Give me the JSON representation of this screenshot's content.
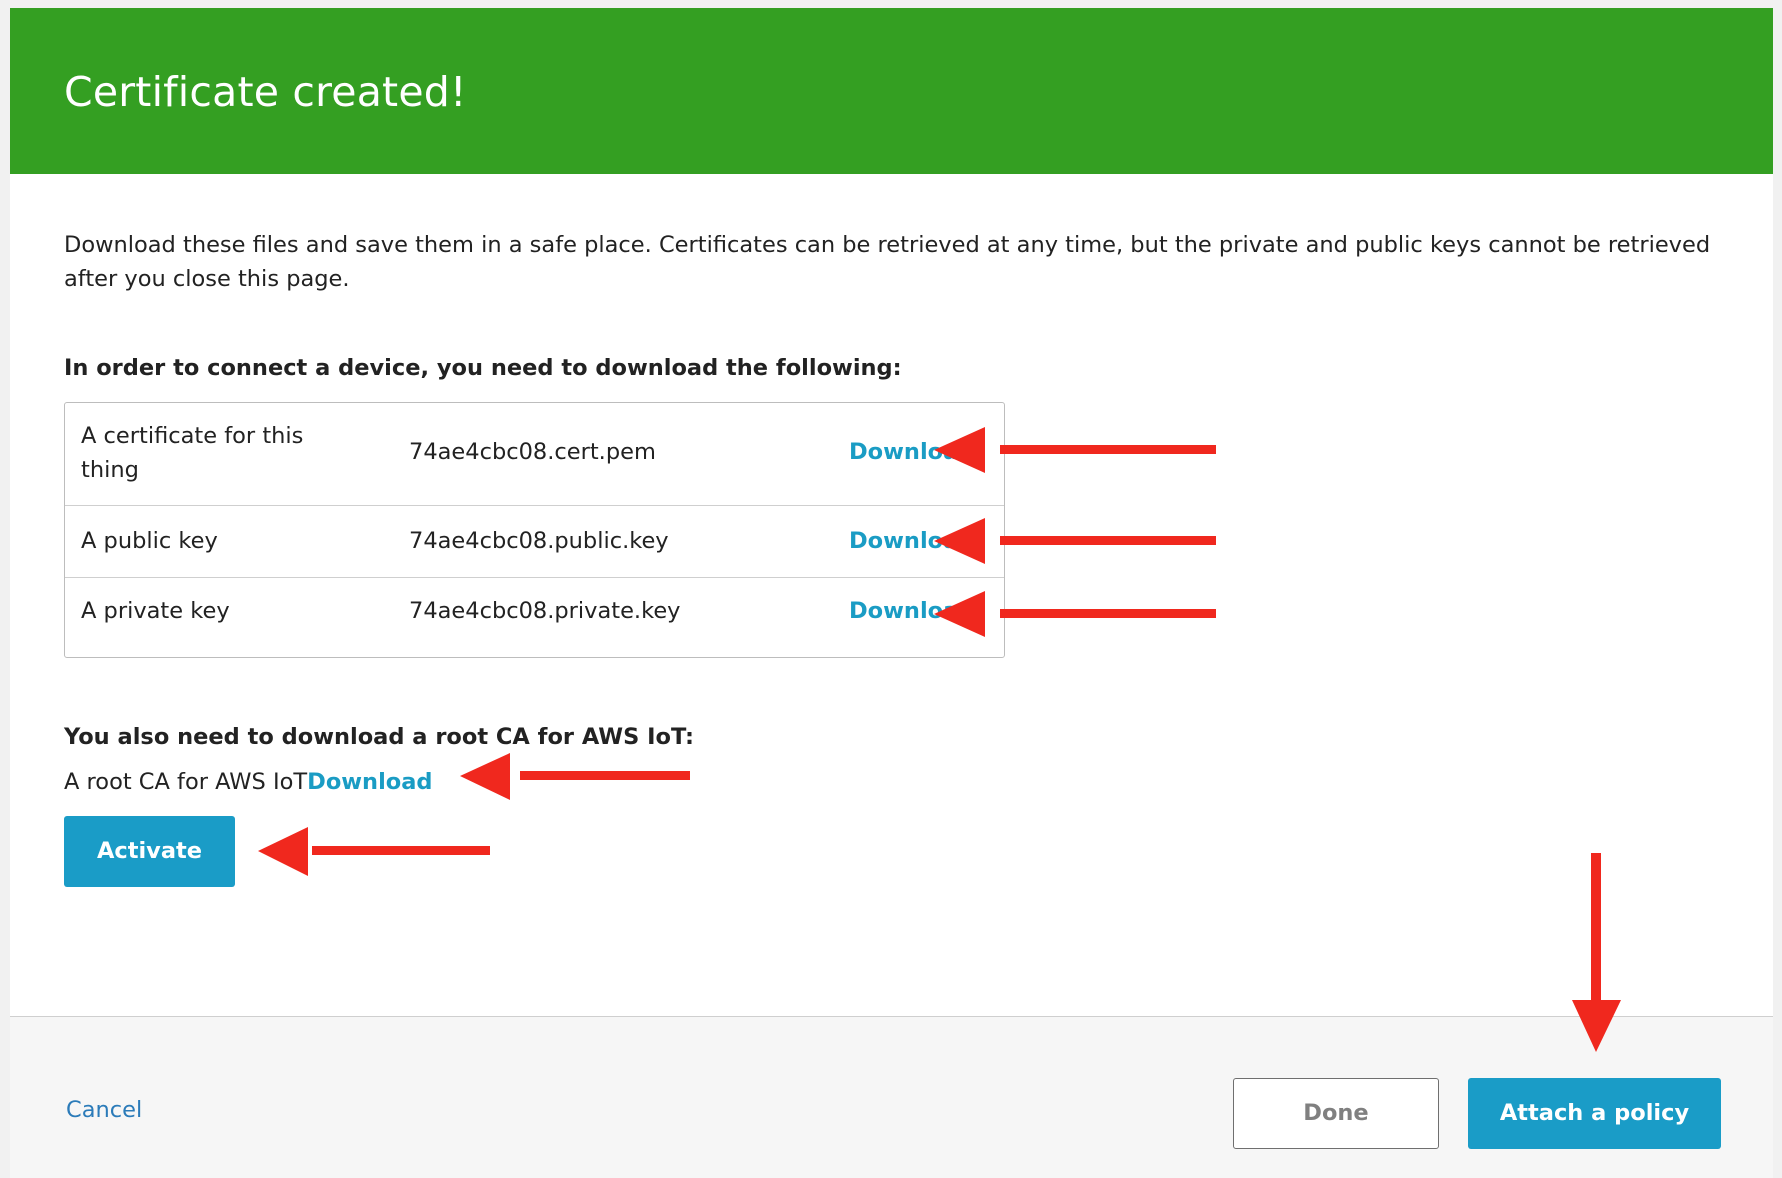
{
  "dialog": {
    "title": "Certificate created!",
    "intro": "Download these files and save them in a safe place. Certificates can be retrieved at any time, but the private and public keys cannot be retrieved after you close this page.",
    "files_heading": "In order to connect a device, you need to download the following:",
    "files": [
      {
        "description": "A certificate for this thing",
        "filename": "74ae4cbc08.cert.pem",
        "link": "Download"
      },
      {
        "description": "A public key",
        "filename": "74ae4cbc08.public.key",
        "link": "Download"
      },
      {
        "description": "A private key",
        "filename": "74ae4cbc08.private.key",
        "link": "Download"
      }
    ],
    "rootca_heading": "You also need to download a root CA for AWS IoT:",
    "rootca_label": "A root CA for AWS IoT",
    "rootca_link": "Download",
    "activate_label": "Activate"
  },
  "footer": {
    "cancel_label": "Cancel",
    "done_label": "Done",
    "attach_label": "Attach a policy"
  },
  "colors": {
    "header_green": "#349f22",
    "primary_blue": "#1a9cc7",
    "link_blue": "#1a9cc4",
    "annotation_red": "#f0281e"
  },
  "annotations": {
    "icon": "red-arrow-icon",
    "count": 6
  }
}
